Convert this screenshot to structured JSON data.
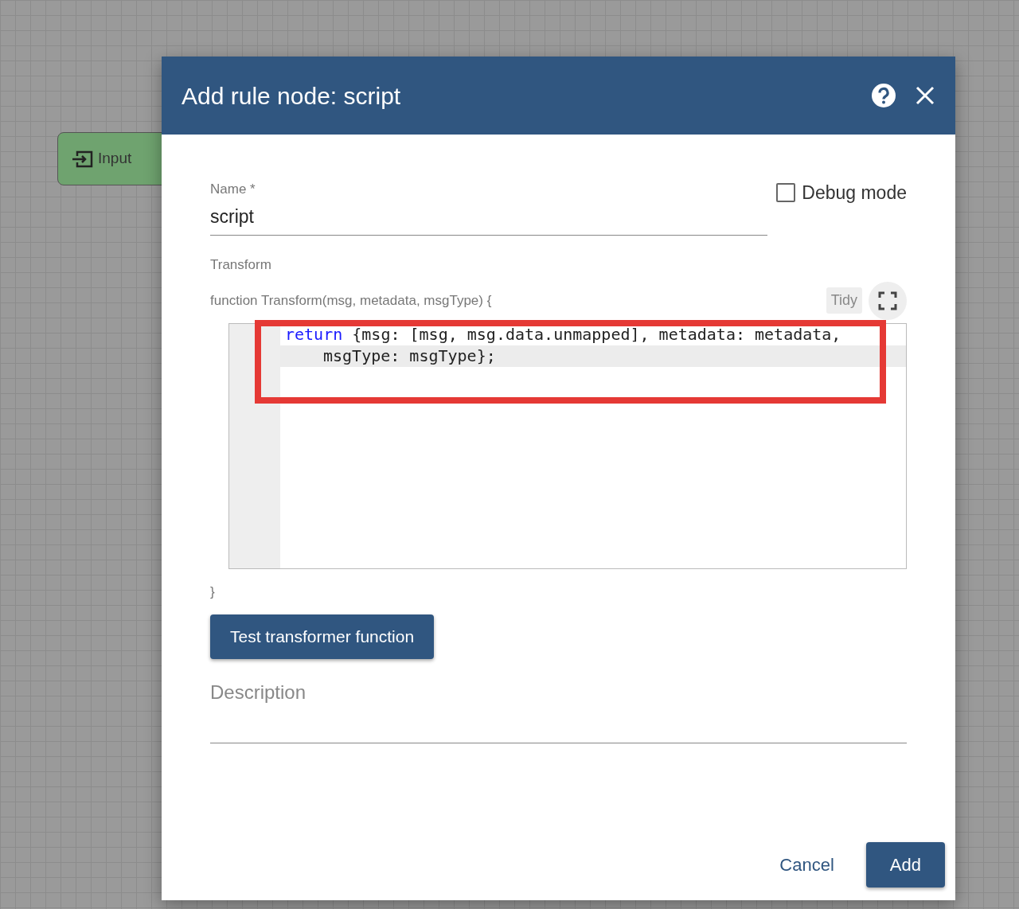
{
  "canvas": {
    "nodes": [
      {
        "label": "Input"
      }
    ]
  },
  "dialog": {
    "title": "Add rule node: script",
    "name_field": {
      "label": "Name *",
      "value": "script"
    },
    "debug_mode": {
      "label": "Debug mode",
      "checked": false
    },
    "transform": {
      "label": "Transform",
      "signature": "function Transform(msg, metadata, msgType) {",
      "tidy": "Tidy",
      "closing": "}",
      "code_lines": [
        {
          "keyword": "return",
          "text": " {msg: [msg, msg.data.unmapped], metadata: metadata,",
          "wrapped": false
        },
        {
          "text": "msgType: msgType};",
          "wrapped": true
        }
      ]
    },
    "test_button": "Test transformer function",
    "description": {
      "placeholder": "Description"
    },
    "buttons": [
      {
        "label": "Cancel",
        "kind": "text"
      },
      {
        "label": "Add",
        "kind": "primary"
      }
    ]
  }
}
